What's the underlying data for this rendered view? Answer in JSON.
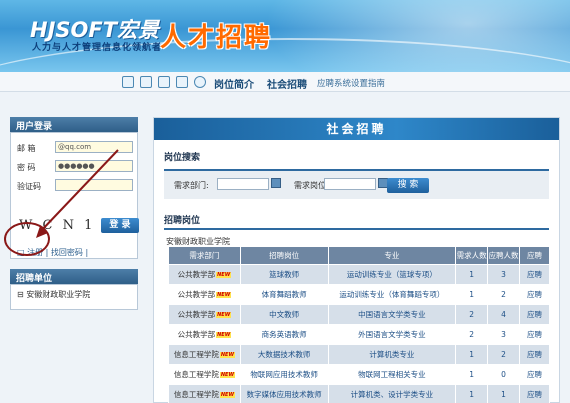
{
  "header": {
    "logo_text": "HJSOFT宏景",
    "slogan": "人力与人才管理信息化领航者",
    "system_title": "人才招聘"
  },
  "nav": {
    "icons": [
      "home-icon",
      "fullscreen-icon",
      "save-icon",
      "share-icon",
      "settings-icon"
    ],
    "links": [
      "岗位简介",
      "社会招聘",
      "应聘系统设置指南"
    ]
  },
  "login": {
    "panel_title": "用户登录",
    "email_label": "邮 箱",
    "email_value": "@qq.com",
    "password_label": "密 码",
    "password_value": "●●●●●●",
    "captcha_label": "验证码",
    "captcha_image_text": "W C N 1",
    "login_button": "登 录",
    "register_link": "注册",
    "forgot_link": "找回密码"
  },
  "units": {
    "panel_title": "招聘单位",
    "items": [
      "安徽财政职业学院"
    ]
  },
  "main": {
    "title": "社会招聘",
    "search": {
      "section_title": "岗位搜索",
      "dept_label": "需求部门:",
      "position_label": "需求岗位:",
      "button": "搜 索"
    },
    "positions_title": "招聘岗位",
    "school_name": "安徽财政职业学院",
    "table": {
      "headers": [
        "需求部门",
        "招聘岗位",
        "专业",
        "需求人数",
        "应聘人数",
        "应聘"
      ],
      "new_badge": "NEW",
      "rows": [
        {
          "dept": "公共教学部",
          "post": "篮球教师",
          "major": "运动训练专业（篮球专项）",
          "need": "1",
          "applied": "3",
          "action": "应聘"
        },
        {
          "dept": "公共教学部",
          "post": "体育舞蹈教师",
          "major": "运动训练专业（体育舞蹈专项）",
          "need": "1",
          "applied": "2",
          "action": "应聘"
        },
        {
          "dept": "公共教学部",
          "post": "中文教师",
          "major": "中国语言文学类专业",
          "need": "2",
          "applied": "4",
          "action": "应聘"
        },
        {
          "dept": "公共教学部",
          "post": "商务英语教师",
          "major": "外国语言文学类专业",
          "need": "2",
          "applied": "3",
          "action": "应聘"
        },
        {
          "dept": "信息工程学院",
          "post": "大数据技术教师",
          "major": "计算机类专业",
          "need": "1",
          "applied": "2",
          "action": "应聘"
        },
        {
          "dept": "信息工程学院",
          "post": "物联网应用技术教师",
          "major": "物联网工程相关专业",
          "need": "1",
          "applied": "0",
          "action": "应聘"
        },
        {
          "dept": "信息工程学院",
          "post": "数字媒体应用技术教师",
          "major": "计算机类、设计学类专业",
          "need": "1",
          "applied": "1",
          "action": "应聘"
        }
      ]
    }
  }
}
